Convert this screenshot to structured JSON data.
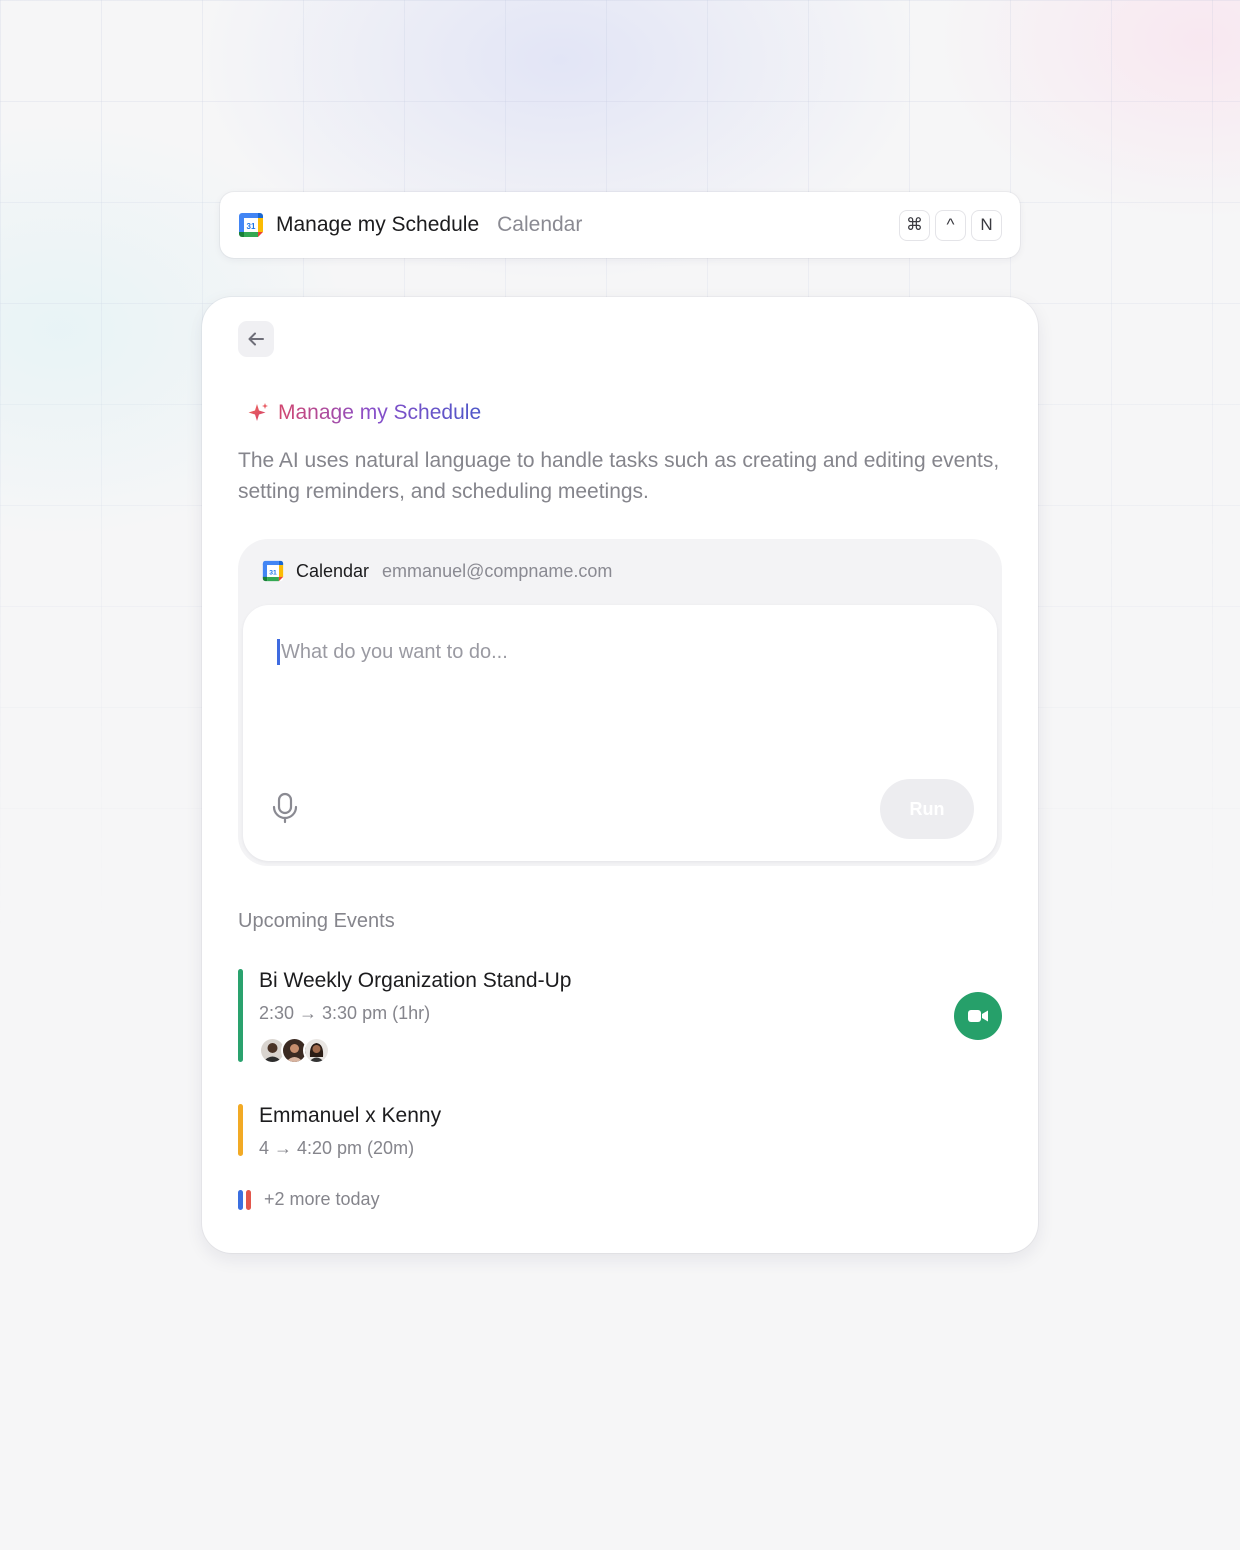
{
  "command_bar": {
    "title": "Manage my Schedule",
    "subtitle": "Calendar",
    "app_icon": "google-calendar-icon",
    "app_icon_text": "31",
    "shortcuts": [
      "⌘",
      "^",
      "N"
    ]
  },
  "card": {
    "back_icon": "arrow-left-icon",
    "feature_icon": "sparkle-icon",
    "feature_title": "Manage my Schedule",
    "description": "The AI uses natural language to handle tasks such as creating and editing events, setting reminders, and scheduling meetings.",
    "account": {
      "app_label": "Calendar",
      "email": "emmanuel@compname.com"
    },
    "prompt": {
      "placeholder": "What do you want to do...",
      "mic_icon": "microphone-icon",
      "run_label": "Run"
    },
    "upcoming": {
      "title": "Upcoming Events",
      "events": [
        {
          "name": "Bi Weekly Organization Stand-Up",
          "time": "2:30 → 3:30 pm (1hr)",
          "color": "#2aa26e",
          "attendees": 3,
          "action_icon": "video-camera-icon"
        },
        {
          "name": "Emmanuel x Kenny",
          "time": "4 → 4:20 pm (20m)",
          "color": "#f2aa25"
        }
      ],
      "more_text": "+2 more today",
      "more_colors": [
        "#3b6fe0",
        "#e2574c"
      ]
    }
  },
  "colors": {
    "accent_gradient": [
      "#d2466e",
      "#8a4fc9",
      "#4d57c8"
    ],
    "video_button": "#26a06a",
    "caret": "#3f6be0"
  }
}
